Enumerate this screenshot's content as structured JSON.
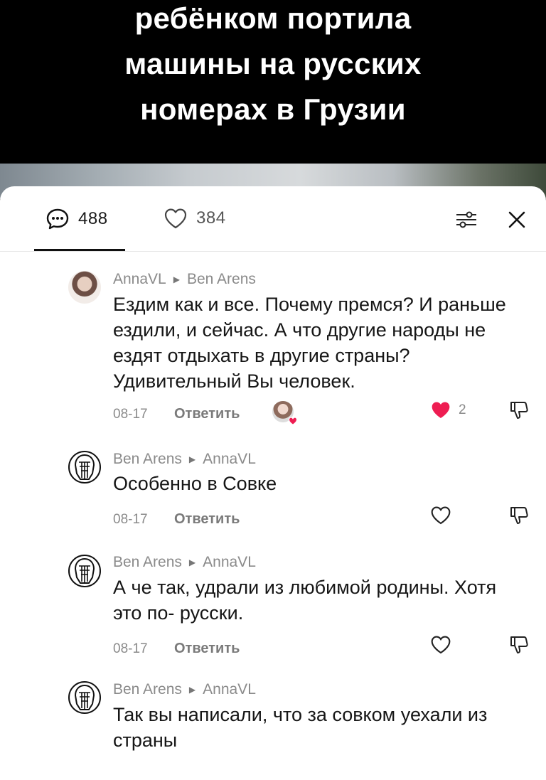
{
  "video": {
    "caption_lines": [
      "ребёнком портила",
      "машины на русских",
      "номерах в Грузии"
    ]
  },
  "sheet": {
    "comment_count": "488",
    "like_count": "384",
    "icons": {
      "comments": "comment-bubble-icon",
      "likes": "heart-outline-icon",
      "filter": "filter-sliders-icon",
      "close": "close-icon"
    }
  },
  "comments": [
    {
      "author": "AnnaVL",
      "reply_to": "Ben Arens",
      "text": "Ездим как и все. Почему премся? И раньше ездили, и сейчас. А что другие народы не ездят отдыхать в другие страны? Удивительный Вы человек.",
      "date": "08-17",
      "reply_label": "Ответить",
      "likes": "2",
      "liked": true,
      "creator_liked": true
    },
    {
      "author": "Ben Arens",
      "reply_to": "AnnaVL",
      "text": "Особенно в Совке",
      "date": "08-17",
      "reply_label": "Ответить",
      "likes": "",
      "liked": false
    },
    {
      "author": "Ben Arens",
      "reply_to": "AnnaVL",
      "text": "А че так, удрали из любимой родины. Хотя это по- русски.",
      "date": "08-17",
      "reply_label": "Ответить",
      "likes": "",
      "liked": false
    },
    {
      "author": "Ben Arens",
      "reply_to": "AnnaVL",
      "text": "Так вы написали, что за совком уехали из страны",
      "date": "",
      "reply_label": "",
      "likes": "",
      "liked": false
    }
  ],
  "colors": {
    "like_red": "#ee1d52",
    "text": "#161616",
    "muted": "#8a8a8a"
  }
}
